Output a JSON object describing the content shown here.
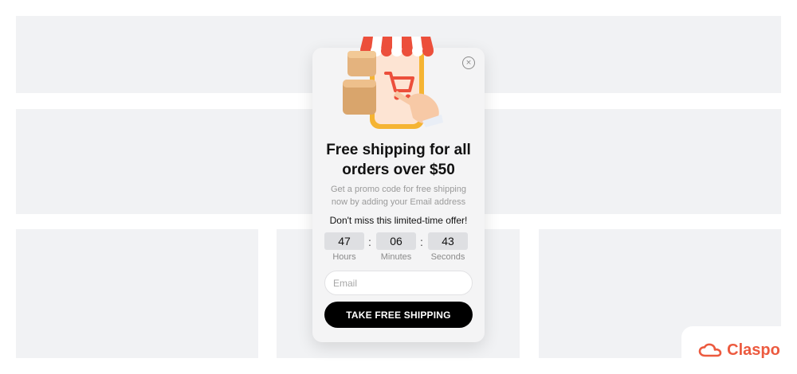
{
  "popup": {
    "title": "Free shipping for all orders over $50",
    "subtitle": "Get a promo code for free shipping now by adding your Email address",
    "offer": "Don't miss this limited-time offer!",
    "timer": {
      "hours": "47",
      "minutes": "06",
      "seconds": "43",
      "hours_label": "Hours",
      "minutes_label": "Minutes",
      "seconds_label": "Seconds",
      "separator": ":"
    },
    "email_placeholder": "Email",
    "cta_label": "TAKE FREE SHIPPING",
    "close_symbol": "×"
  },
  "brand": {
    "name": "Claspo",
    "color": "#ec5a3f"
  },
  "colors": {
    "placeholder_bg": "#f1f2f4",
    "popup_bg": "#f4f4f5",
    "cta_bg": "#000000",
    "accent_red": "#ec4f3b"
  },
  "icons": {
    "close": "close-icon",
    "hero": "shop-phone-illustration",
    "brand_logo": "cloud-logo-icon"
  }
}
